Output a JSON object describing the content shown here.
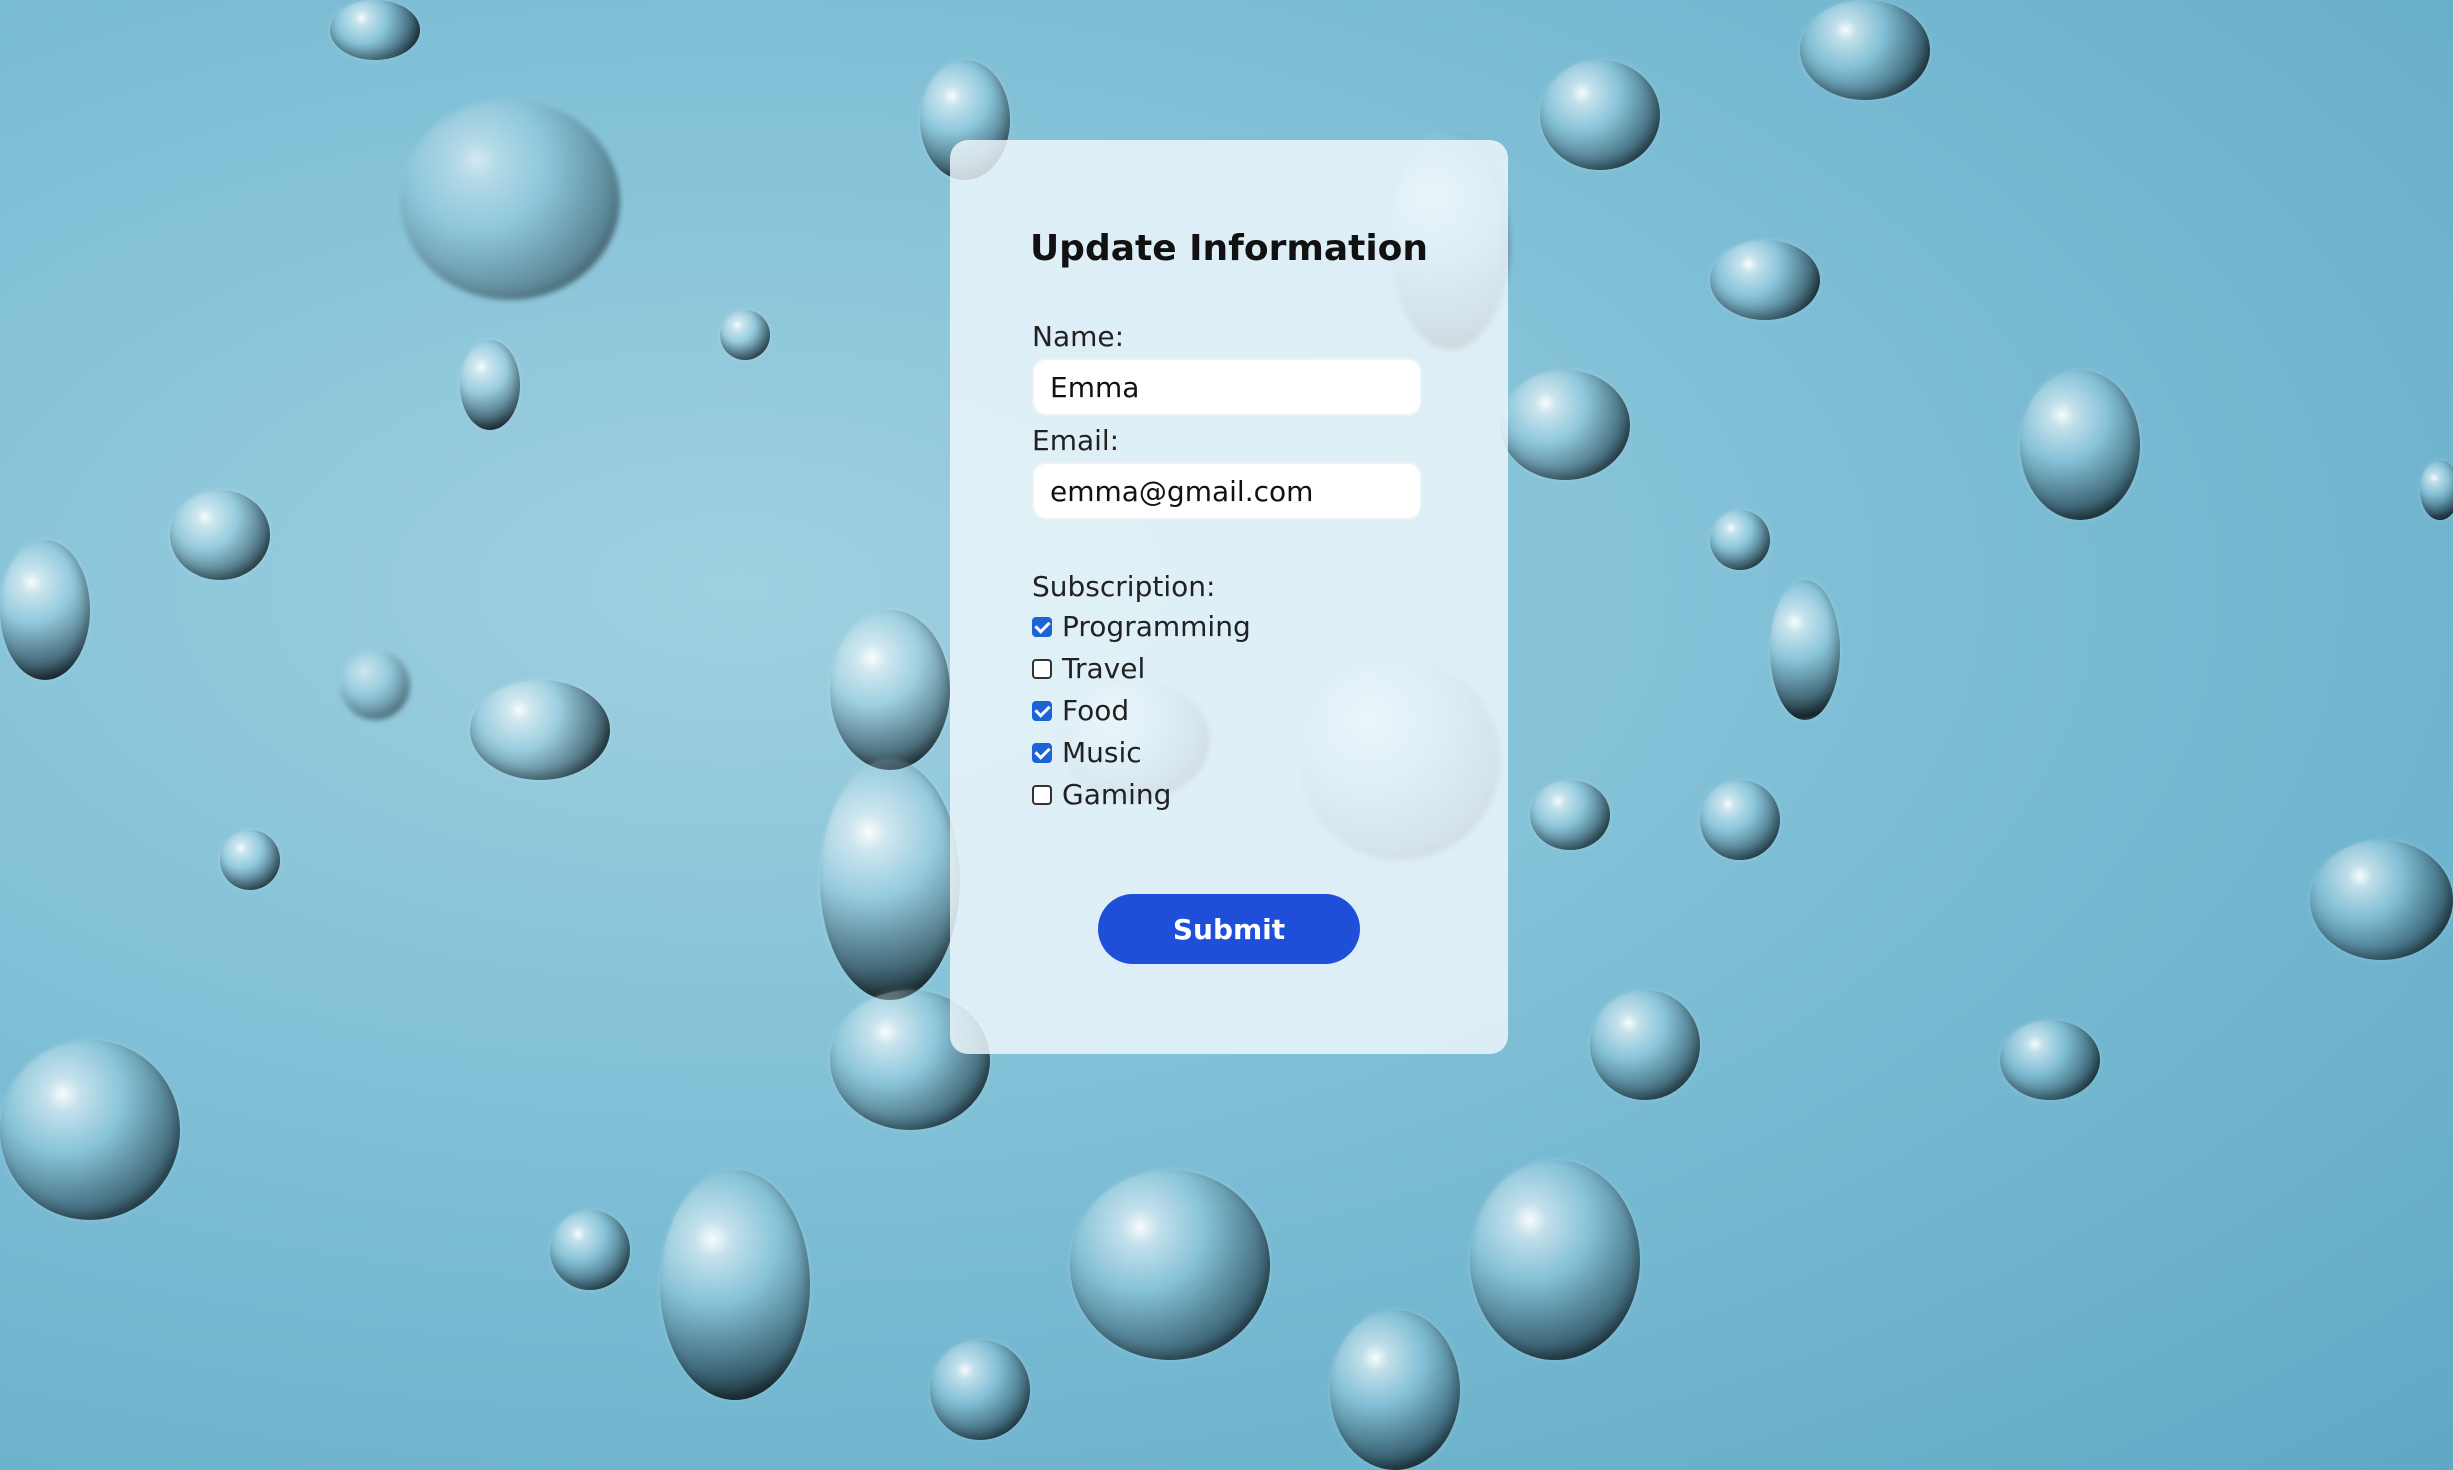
{
  "form": {
    "title": "Update Information",
    "name_label": "Name:",
    "name_value": "Emma",
    "email_label": "Email:",
    "email_value": "emma@gmail.com",
    "subscription_label": "Subscription:",
    "subscriptions": [
      {
        "label": "Programming",
        "checked": true
      },
      {
        "label": "Travel",
        "checked": false
      },
      {
        "label": "Food",
        "checked": true
      },
      {
        "label": "Music",
        "checked": true
      },
      {
        "label": "Gaming",
        "checked": false
      }
    ],
    "submit_label": "Submit"
  },
  "colors": {
    "accent": "#1f4fd8",
    "checkbox": "#1d63d8",
    "background": "#7fbfd6"
  }
}
